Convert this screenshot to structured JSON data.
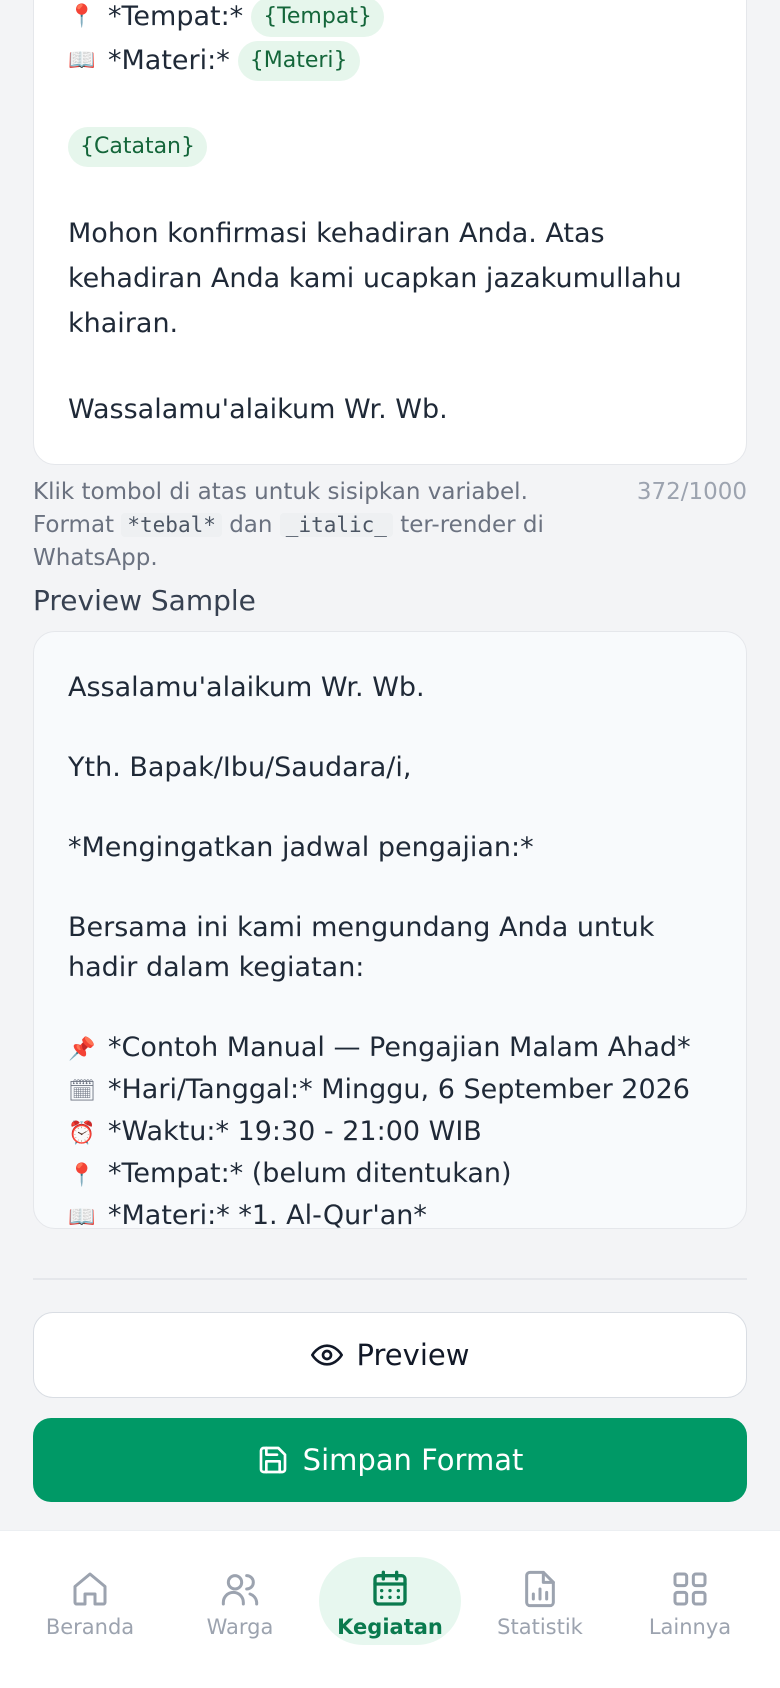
{
  "editor": {
    "lines": [
      {
        "icon": "📍",
        "label": "*Tempat:*",
        "chip": "{Tempat}"
      },
      {
        "icon": "📖",
        "label": "*Materi:*",
        "chip": "{Materi}"
      }
    ],
    "catatan_chip": "{Catatan}",
    "paragraph1": "Mohon konfirmasi kehadiran Anda. Atas kehadiran Anda kami ucapkan jazakumullahu khairan.",
    "closing": "Wassalamu'alaikum Wr. Wb."
  },
  "helper": {
    "text_before": "Klik tombol di atas untuk sisipkan variabel. Format ",
    "bold_code": "*tebal*",
    "text_mid": " dan ",
    "italic_code": "_italic_",
    "text_after": " ter-render di WhatsApp.",
    "counter": "372/1000"
  },
  "preview_section": {
    "title": "Preview Sample",
    "greeting": "Assalamu'alaikum Wr. Wb.",
    "recipient": "Yth. Bapak/Ibu/Saudara/i,",
    "reminder": "*Mengingatkan jadwal pengajian:*",
    "invite": "Bersama ini kami mengundang Anda untuk hadir dalam kegiatan:",
    "details": [
      {
        "icon": "📌",
        "text": "*Contoh Manual — Pengajian Malam Ahad*"
      },
      {
        "icon": "🗓",
        "text": "*Hari/Tanggal:* Minggu, 6 September 2026"
      },
      {
        "icon": "⏰",
        "text": "*Waktu:* 19:30 - 21:00 WIB"
      },
      {
        "icon": "📍",
        "text": "*Tempat:* (belum ditentukan)"
      },
      {
        "icon": "📖",
        "text": "*Materi:* *1. Al-Qur'an*"
      }
    ]
  },
  "buttons": {
    "preview_label": "Preview",
    "save_label": "Simpan Format"
  },
  "nav": {
    "items": [
      {
        "label": "Beranda",
        "icon": "home-icon"
      },
      {
        "label": "Warga",
        "icon": "users-icon"
      },
      {
        "label": "Kegiatan",
        "icon": "calendar-icon",
        "active": true
      },
      {
        "label": "Statistik",
        "icon": "chart-icon"
      },
      {
        "label": "Lainnya",
        "icon": "grid-icon"
      }
    ]
  },
  "colors": {
    "primary": "#009966",
    "chip_bg": "#e6f6ec",
    "chip_text": "#14663a"
  }
}
